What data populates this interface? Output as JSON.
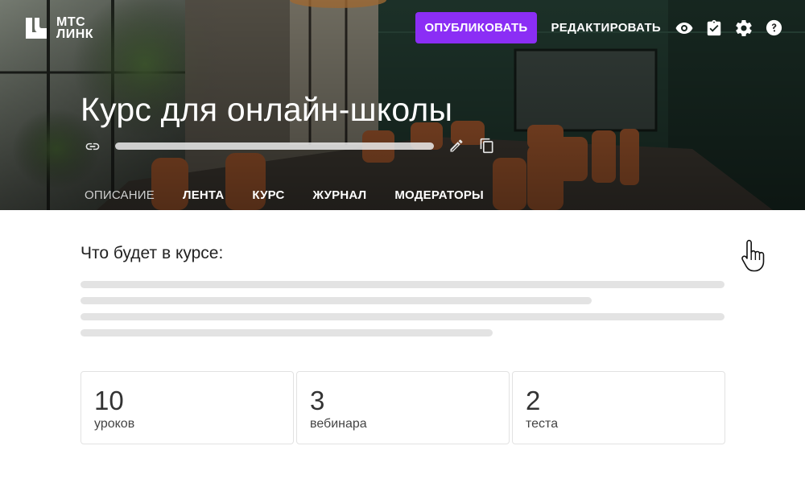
{
  "brand": {
    "name_line1": "МТС",
    "name_line2": "ЛИНК"
  },
  "header": {
    "publish_label": "ОПУБЛИКОВАТЬ",
    "edit_label": "РЕДАКТИРОВАТЬ",
    "icons": [
      "eye-icon",
      "checklist-icon",
      "gear-icon",
      "help-icon"
    ],
    "accent": "#8b2ef5"
  },
  "course": {
    "title": "Курс для онлайн-школы"
  },
  "tabs": [
    {
      "label": "ОПИСАНИЕ",
      "active": true
    },
    {
      "label": "ЛЕНТА",
      "active": false
    },
    {
      "label": "КУРС",
      "active": false
    },
    {
      "label": "ЖУРНАЛ",
      "active": false
    },
    {
      "label": "МОДЕРАТОРЫ",
      "active": false
    }
  ],
  "description": {
    "heading": "Что будет в курсе:"
  },
  "stats": [
    {
      "value": "10",
      "label": "уроков"
    },
    {
      "value": "3",
      "label": "вебинара"
    },
    {
      "value": "2",
      "label": "теста"
    }
  ]
}
